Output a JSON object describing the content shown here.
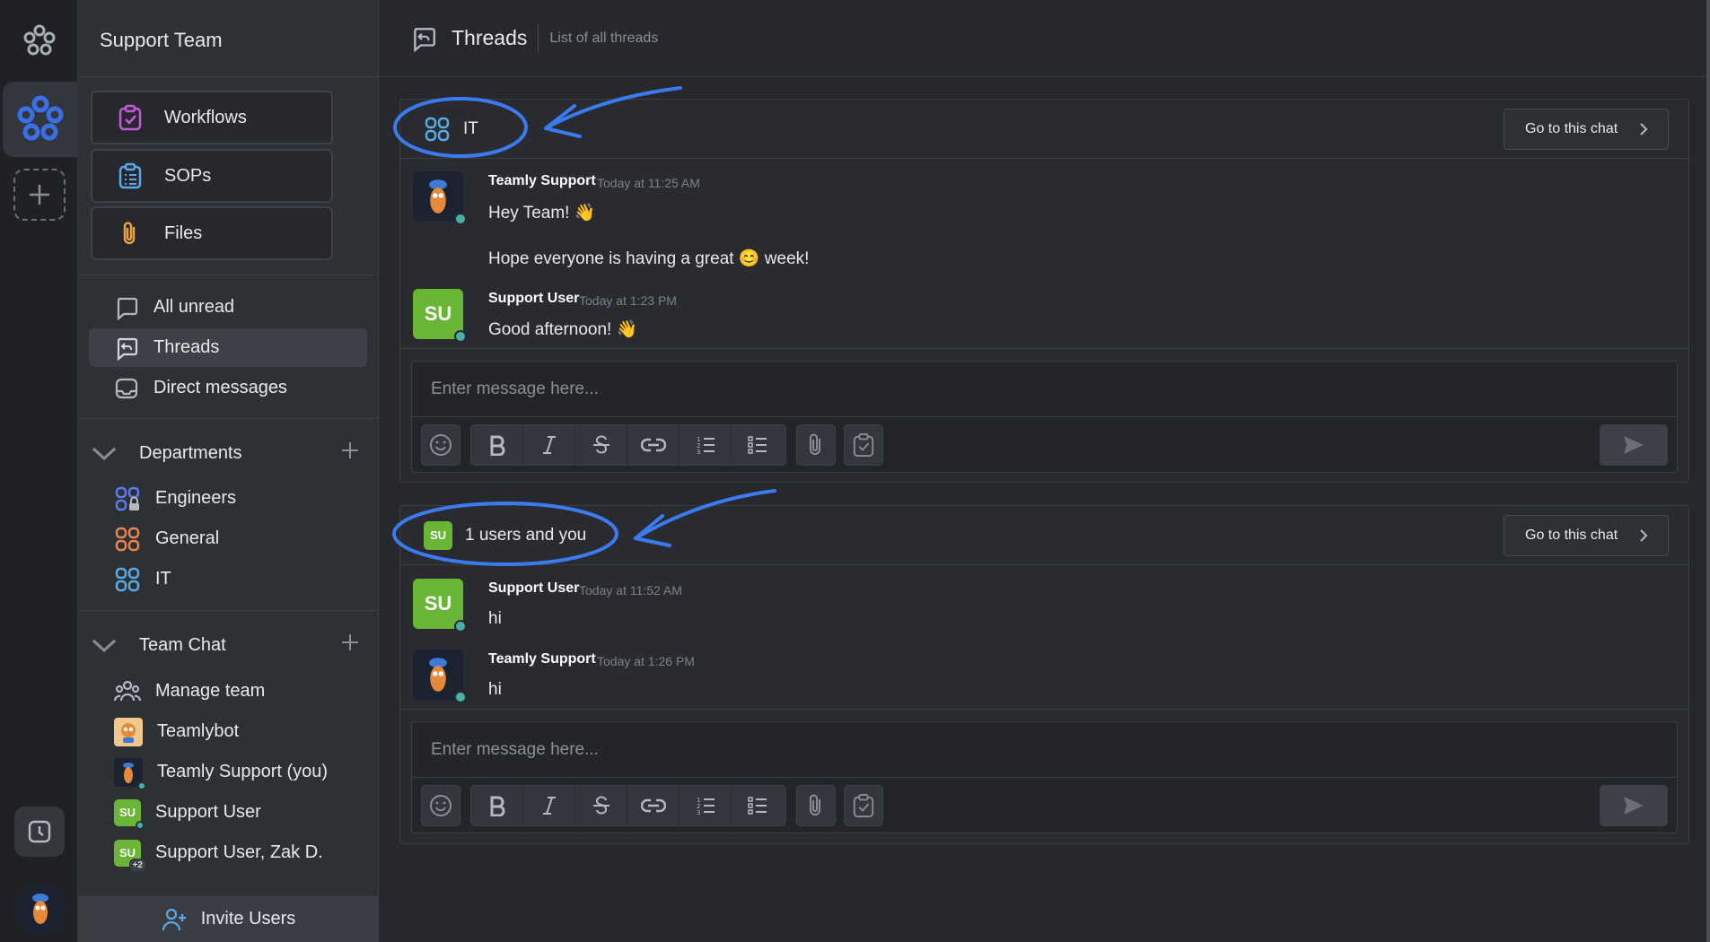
{
  "sidebar": {
    "team_name": "Support Team",
    "big_buttons": [
      {
        "label": "Workflows",
        "icon": "clipboard-check-icon",
        "color": "#c35ad9"
      },
      {
        "label": "SOPs",
        "icon": "clipboard-list-icon",
        "color": "#5aa8e6"
      },
      {
        "label": "Files",
        "icon": "paperclip-icon",
        "color": "#e8a33c"
      }
    ],
    "nav": [
      {
        "label": "All unread",
        "icon": "chat-bubble-icon"
      },
      {
        "label": "Threads",
        "icon": "thread-reply-icon",
        "active": true
      },
      {
        "label": "Direct messages",
        "icon": "inbox-icon"
      }
    ],
    "departments": {
      "title": "Departments",
      "items": [
        {
          "label": "Engineers",
          "color": "#5b7cf0",
          "locked": true
        },
        {
          "label": "General",
          "color": "#e8854a"
        },
        {
          "label": "IT",
          "color": "#5aa8e6"
        }
      ]
    },
    "team_chat": {
      "title": "Team Chat",
      "items": [
        {
          "label": "Manage team"
        },
        {
          "label": "Teamlybot"
        },
        {
          "label": "Teamly Support (you)"
        },
        {
          "label": "Support User",
          "avatar": "SU"
        },
        {
          "label": "Support User, Zak D.",
          "avatar": "SU",
          "badge": "+2"
        }
      ]
    },
    "invite_label": "Invite Users"
  },
  "header": {
    "title": "Threads",
    "subtitle": "List of all threads"
  },
  "threads": [
    {
      "name": "IT",
      "goto_label": "Go to this chat",
      "messages": [
        {
          "author": "Teamly Support",
          "time": "Today at 11:25 AM",
          "lines": [
            "Hey Team! 👋",
            "Hope everyone is having a great 😊 week!"
          ]
        },
        {
          "author": "Support User",
          "avatar": "SU",
          "time": "Today at 1:23 PM",
          "lines": [
            "Good afternoon! 👋"
          ]
        }
      ],
      "placeholder": "Enter message here..."
    },
    {
      "name": "1 users and you",
      "avatar": "SU",
      "goto_label": "Go to this chat",
      "messages": [
        {
          "author": "Support User",
          "avatar": "SU",
          "time": "Today at 11:52 AM",
          "lines": [
            "hi"
          ]
        },
        {
          "author": "Teamly Support",
          "time": "Today at 1:26 PM",
          "lines": [
            "hi"
          ]
        }
      ],
      "placeholder": "Enter message here..."
    }
  ],
  "colors": {
    "accent": "#3b82f6",
    "su_green": "#6bb536",
    "online": "#46b1a8",
    "annotation": "#3b7bf0"
  }
}
